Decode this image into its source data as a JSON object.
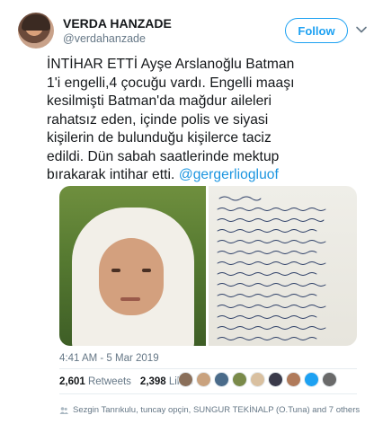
{
  "author": {
    "display_name": "VERDA HANZADE",
    "handle": "@verdahanzade",
    "avatar_icon": "avatar-photo"
  },
  "follow_button": {
    "label": "Follow",
    "color": "#1da1f2"
  },
  "menu_icon": "chevron-down-icon",
  "tweet": {
    "text_lines": [
      "İNTİHAR ETTİ Ayşe Arslanoğlu Batman",
      "1'i engelli,4 çocuğu vardı. Engelli maaşı",
      "kesilmişti Batman'da mağdur aileleri",
      "rahatsız eden, içinde polis ve siyasi",
      "kişilerin de bulunduğu kişilerce taciz",
      "edildi. Dün sabah saatlerinde mektup",
      "bırakarak intihar etti."
    ],
    "mention": "@gergerliogluof",
    "mention_color": "#1b95e0"
  },
  "media": {
    "photo_alt": "woman-in-headscarf-photo",
    "letter_alt": "handwritten-letter-photo"
  },
  "timestamp": "4:41 AM - 5 Mar 2019",
  "stats": {
    "retweets_count": "2,601",
    "retweets_label": "Retweets",
    "likes_count": "2,398",
    "likes_label": "Likes"
  },
  "liker_avatar_colors": [
    "#8a6f5a",
    "#c9a27e",
    "#4a6b8a",
    "#7a8a4a",
    "#d9c0a0",
    "#3a3a4a",
    "#b07a5a",
    "#1da1f2",
    "#6a6a6a"
  ],
  "social_context": "Sezgin Tanrıkulu, tuncay opçin, SUNGUR TEKİNALP (O.Tuna) and 7 others"
}
